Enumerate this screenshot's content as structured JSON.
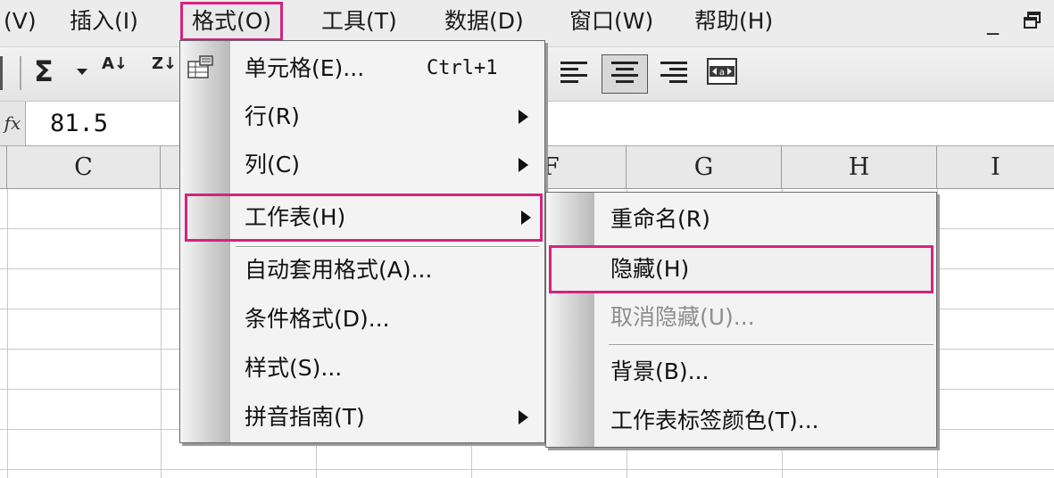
{
  "menubar": {
    "items": [
      {
        "label": "(V)"
      },
      {
        "label": "插入(I)"
      },
      {
        "label": "格式(O)"
      },
      {
        "label": "工具(T)"
      },
      {
        "label": "数据(D)"
      },
      {
        "label": "窗口(W)"
      },
      {
        "label": "帮助(H)"
      }
    ],
    "minimize_glyph": "_",
    "restore_glyph": "🗗"
  },
  "toolbar": {
    "sum_glyph": "Σ",
    "sort_asc_glyph": "A↓",
    "sort_desc_glyph": "Z↓"
  },
  "formula": {
    "fx_label": "fx",
    "value": "81.5"
  },
  "columns": [
    "C",
    "F",
    "G",
    "H",
    "I"
  ],
  "format_menu": {
    "items": [
      {
        "label": "单元格(E)...",
        "shortcut": "Ctrl+1"
      },
      {
        "label": "行(R)"
      },
      {
        "label": "列(C)"
      },
      {
        "label": "工作表(H)"
      },
      {
        "label": "自动套用格式(A)..."
      },
      {
        "label": "条件格式(D)..."
      },
      {
        "label": "样式(S)..."
      },
      {
        "label": "拼音指南(T)"
      }
    ]
  },
  "sheet_submenu": {
    "items": [
      {
        "label": "重命名(R)"
      },
      {
        "label": "隐藏(H)"
      },
      {
        "label": "取消隐藏(U)..."
      },
      {
        "label": "背景(B)..."
      },
      {
        "label": "工作表标签颜色(T)..."
      }
    ]
  },
  "colors": {
    "highlight_border": "#d4237f",
    "menu_bg": "#f3f3f3",
    "disabled_text": "#8e8e8e"
  }
}
